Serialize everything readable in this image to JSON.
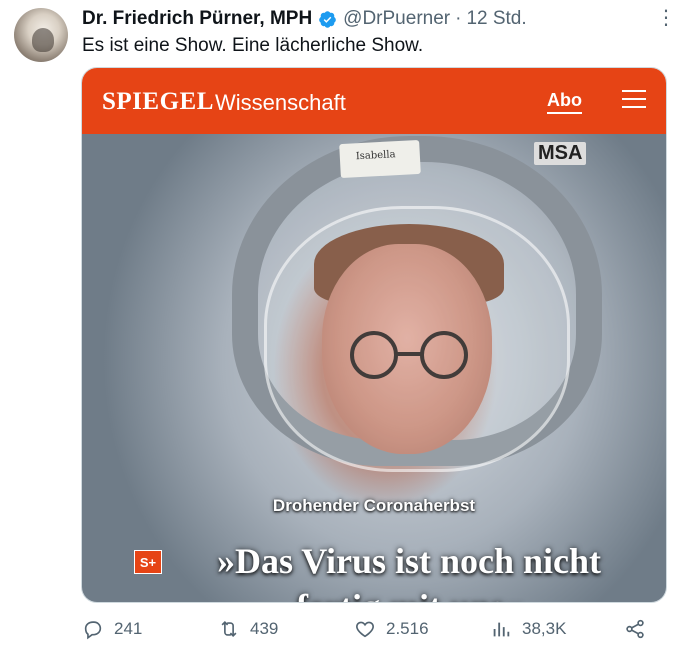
{
  "tweet": {
    "author_name": "Dr. Friedrich Pürner, MPH",
    "handle": "@DrPuerner",
    "separator": "·",
    "time": "12 Std.",
    "text": "Es ist eine Show. Eine lächerliche Show.",
    "more_icon": "more-icon",
    "verified_icon": "verified-badge-icon"
  },
  "media": {
    "brand": "SPIEGEL",
    "section": "Wissenschaft",
    "abo_label": "Abo",
    "menu_icon": "hamburger-menu-icon",
    "helmet_label": "Isabella",
    "helmet_brand": "MSA",
    "kicker": "Drohender Coronaherbst",
    "badge": "S+",
    "headline_line1": "»Das Virus ist noch nicht",
    "headline_line2": "fertig mit uns«",
    "brand_color": "#e64415"
  },
  "actions": {
    "replies": "241",
    "retweets": "439",
    "likes": "2.516",
    "views": "38,3K",
    "reply_icon": "reply-icon",
    "retweet_icon": "retweet-icon",
    "like_icon": "heart-icon",
    "views_icon": "views-icon",
    "share_icon": "share-icon"
  }
}
